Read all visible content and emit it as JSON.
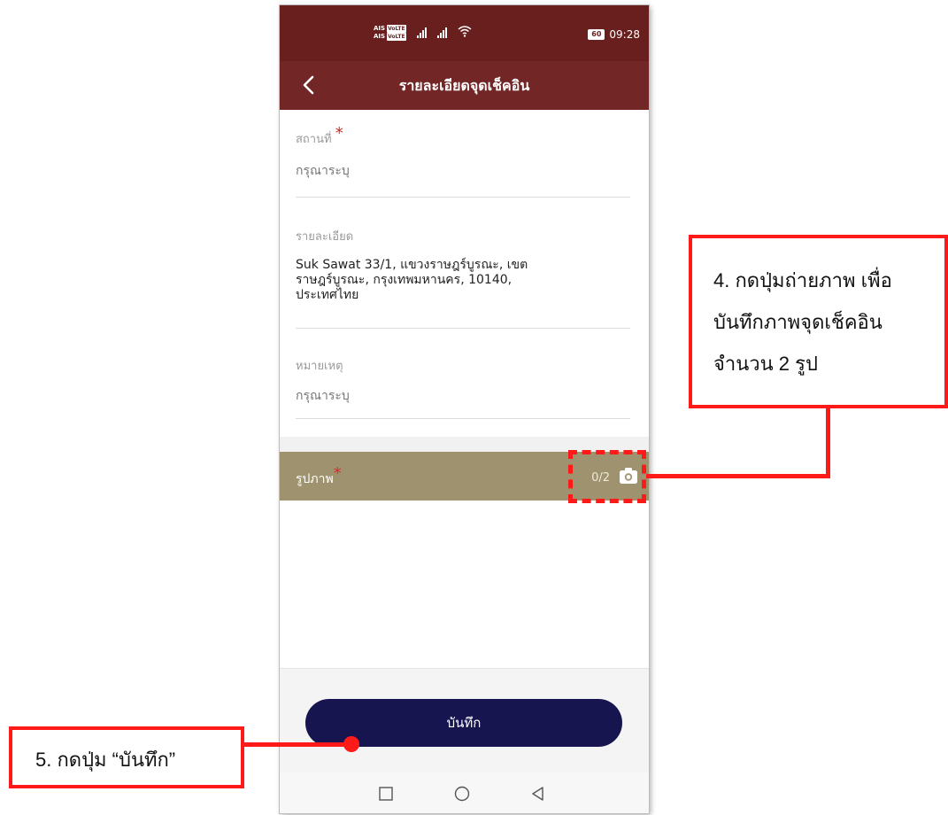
{
  "statusbar": {
    "carrier1": "AIS",
    "carrier2": "AIS",
    "volte": "VoLTE",
    "battery": "60",
    "time": "09:28"
  },
  "appbar": {
    "title": "รายละเอียดจุดเช็คอิน",
    "back_icon": "chevron-left-icon"
  },
  "form": {
    "place": {
      "label": "สถานที่",
      "required": "*",
      "placeholder": "กรุณาระบุ"
    },
    "detail": {
      "label": "รายละเอียด",
      "value": "Suk Sawat 33/1, แขวงราษฎร์บูรณะ, เขต\nราษฎร์บูรณะ, กรุงเทพมหานคร, 10140,\nประเทศไทย"
    },
    "remark": {
      "label": "หมายเหตุ",
      "placeholder": "กรุณาระบุ"
    }
  },
  "photos": {
    "label": "รูปภาพ",
    "required": "*",
    "count": "0/2",
    "camera_icon": "camera-icon"
  },
  "save_button": "บันทึก",
  "android_nav": [
    "square-icon",
    "circle-icon",
    "triangle-back-icon"
  ],
  "annotations": {
    "step4": [
      "4. กดปุ่มถ่ายภาพ เพื่อ",
      "บันทึกภาพจุดเช็คอิน",
      "จำนวน 2 รูป"
    ],
    "step5": "5. กดปุ่ม “บันทึก”"
  },
  "colors": {
    "statusbar": "#6a1f1f",
    "appbar": "#722626",
    "photo_bar": "#9f936f",
    "save_button": "#17154f",
    "annotation_red": "#ff1a1a"
  }
}
